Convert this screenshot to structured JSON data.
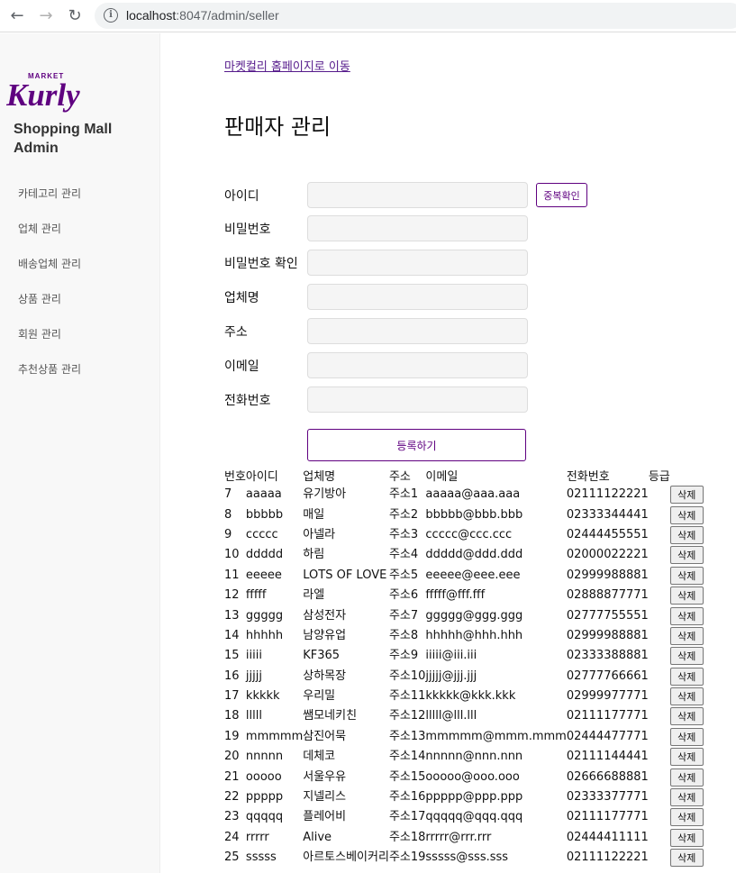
{
  "browser": {
    "url_host": "localhost",
    "url_rest": ":8047/admin/seller"
  },
  "sidebar": {
    "logo_small": "MARKET",
    "logo_big": "Kurly",
    "brand_line1": "Shopping Mall",
    "brand_line2": "Admin",
    "items": [
      {
        "label": "카테고리 관리"
      },
      {
        "label": "업체 관리"
      },
      {
        "label": "배송업체 관리"
      },
      {
        "label": "상품 관리"
      },
      {
        "label": "회원 관리"
      },
      {
        "label": "추천상품 관리"
      }
    ]
  },
  "main": {
    "home_link": "마켓컬리 홈페이지로 이동",
    "title": "판매자 관리"
  },
  "form": {
    "id_label": "아이디",
    "dup_check": "중복확인",
    "password_label": "비밀번호",
    "password_confirm_label": "비밀번호 확인",
    "company_label": "업체명",
    "address_label": "주소",
    "email_label": "이메일",
    "phone_label": "전화번호",
    "submit": "등록하기"
  },
  "table": {
    "headers": {
      "no": "번호",
      "id": "아이디",
      "name": "업체명",
      "addr": "주소",
      "email": "이메일",
      "tel": "전화번호",
      "grade": "등급"
    },
    "delete_label": "삭제",
    "rows": [
      {
        "no": "7",
        "id": "aaaaa",
        "name": "유기방아",
        "addr": "주소1",
        "email": "aaaaa@aaa.aaa",
        "tel": "02111122221",
        "grade": ""
      },
      {
        "no": "8",
        "id": "bbbbb",
        "name": "매일",
        "addr": "주소2",
        "email": "bbbbb@bbb.bbb",
        "tel": "02333344441",
        "grade": ""
      },
      {
        "no": "9",
        "id": "ccccc",
        "name": "아넬라",
        "addr": "주소3",
        "email": "ccccc@ccc.ccc",
        "tel": "02444455551",
        "grade": ""
      },
      {
        "no": "10",
        "id": "ddddd",
        "name": "하림",
        "addr": "주소4",
        "email": "ddddd@ddd.ddd",
        "tel": "02000022221",
        "grade": ""
      },
      {
        "no": "11",
        "id": "eeeee",
        "name": "LOTS OF LOVE",
        "addr": "주소5",
        "email": "eeeee@eee.eee",
        "tel": "02999988881",
        "grade": ""
      },
      {
        "no": "12",
        "id": "fffff",
        "name": "라엘",
        "addr": "주소6",
        "email": "fffff@fff.fff",
        "tel": "02888877771",
        "grade": ""
      },
      {
        "no": "13",
        "id": "ggggg",
        "name": "삼성전자",
        "addr": "주소7",
        "email": "ggggg@ggg.ggg",
        "tel": "02777755551",
        "grade": ""
      },
      {
        "no": "14",
        "id": "hhhhh",
        "name": "남양유업",
        "addr": "주소8",
        "email": "hhhhh@hhh.hhh",
        "tel": "02999988881",
        "grade": ""
      },
      {
        "no": "15",
        "id": "iiiii",
        "name": "KF365",
        "addr": "주소9",
        "email": "iiiii@iii.iii",
        "tel": "02333388881",
        "grade": ""
      },
      {
        "no": "16",
        "id": "jjjjj",
        "name": "상하목장",
        "addr": "주소10",
        "email": "jjjjj@jjj.jjj",
        "tel": "02777766661",
        "grade": ""
      },
      {
        "no": "17",
        "id": "kkkkk",
        "name": "우리밀",
        "addr": "주소11",
        "email": "kkkkk@kkk.kkk",
        "tel": "02999977771",
        "grade": ""
      },
      {
        "no": "18",
        "id": "lllll",
        "name": "쌤모네키친",
        "addr": "주소12",
        "email": "lllll@lll.lll",
        "tel": "02111177771",
        "grade": ""
      },
      {
        "no": "19",
        "id": "mmmmm",
        "name": "삼진어묵",
        "addr": "주소13",
        "email": "mmmmm@mmm.mmm",
        "tel": "02444477771",
        "grade": ""
      },
      {
        "no": "20",
        "id": "nnnnn",
        "name": "데체코",
        "addr": "주소14",
        "email": "nnnnn@nnn.nnn",
        "tel": "02111144441",
        "grade": ""
      },
      {
        "no": "21",
        "id": "ooooo",
        "name": "서울우유",
        "addr": "주소15",
        "email": "ooooo@ooo.ooo",
        "tel": "02666688881",
        "grade": ""
      },
      {
        "no": "22",
        "id": "ppppp",
        "name": "지넬리스",
        "addr": "주소16",
        "email": "ppppp@ppp.ppp",
        "tel": "02333377771",
        "grade": ""
      },
      {
        "no": "23",
        "id": "qqqqq",
        "name": "플레어비",
        "addr": "주소17",
        "email": "qqqqq@qqq.qqq",
        "tel": "02111177771",
        "grade": ""
      },
      {
        "no": "24",
        "id": "rrrrr",
        "name": "Alive",
        "addr": "주소18",
        "email": "rrrrr@rrr.rrr",
        "tel": "02444411111",
        "grade": ""
      },
      {
        "no": "25",
        "id": "sssss",
        "name": "아르토스베이커리",
        "addr": "주소19",
        "email": "sssss@sss.sss",
        "tel": "02111122221",
        "grade": ""
      }
    ]
  },
  "colors": {
    "accent": "#5f0080",
    "link": "#551a8b",
    "sidebar_bg": "#f8f8f8"
  },
  "icons": [
    "back-arrow-icon",
    "forward-arrow-icon",
    "reload-icon",
    "info-icon"
  ]
}
